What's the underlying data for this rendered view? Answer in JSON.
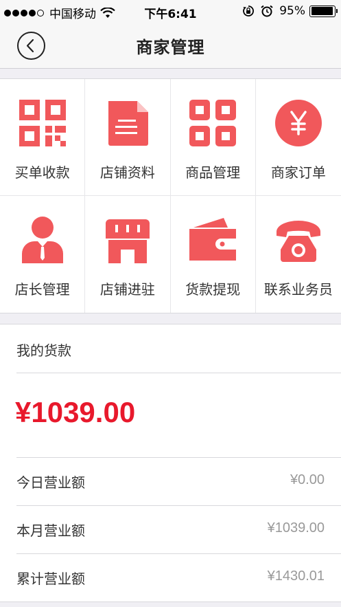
{
  "status_bar": {
    "carrier": "中国移动",
    "time": "下午6:41",
    "battery": "95%",
    "battery_level": 0.95,
    "signal_bars": 4,
    "icons": [
      "signal-dots-icon",
      "wifi-icon",
      "rotation-lock-icon",
      "alarm-icon",
      "battery-icon"
    ]
  },
  "nav": {
    "title": "商家管理",
    "back_icon": "back-chevron-icon"
  },
  "accent_color": "#f1585b",
  "price_color": "#e8192c",
  "menu": [
    {
      "label": "买单收款",
      "icon": "qr-code-icon"
    },
    {
      "label": "店铺资料",
      "icon": "document-icon"
    },
    {
      "label": "商品管理",
      "icon": "grid-squares-icon"
    },
    {
      "label": "商家订单",
      "icon": "yen-coin-icon"
    },
    {
      "label": "店长管理",
      "icon": "manager-person-icon"
    },
    {
      "label": "店铺进驻",
      "icon": "storefront-icon"
    },
    {
      "label": "货款提现",
      "icon": "wallet-icon"
    },
    {
      "label": "联系业务员",
      "icon": "telephone-icon"
    }
  ],
  "money": {
    "title": "我的货款",
    "balance": "¥1039.00",
    "rows": [
      {
        "label": "今日营业额",
        "value": "¥0.00"
      },
      {
        "label": "本月营业额",
        "value": "¥1039.00"
      },
      {
        "label": "累计营业额",
        "value": "¥1430.01"
      }
    ]
  }
}
